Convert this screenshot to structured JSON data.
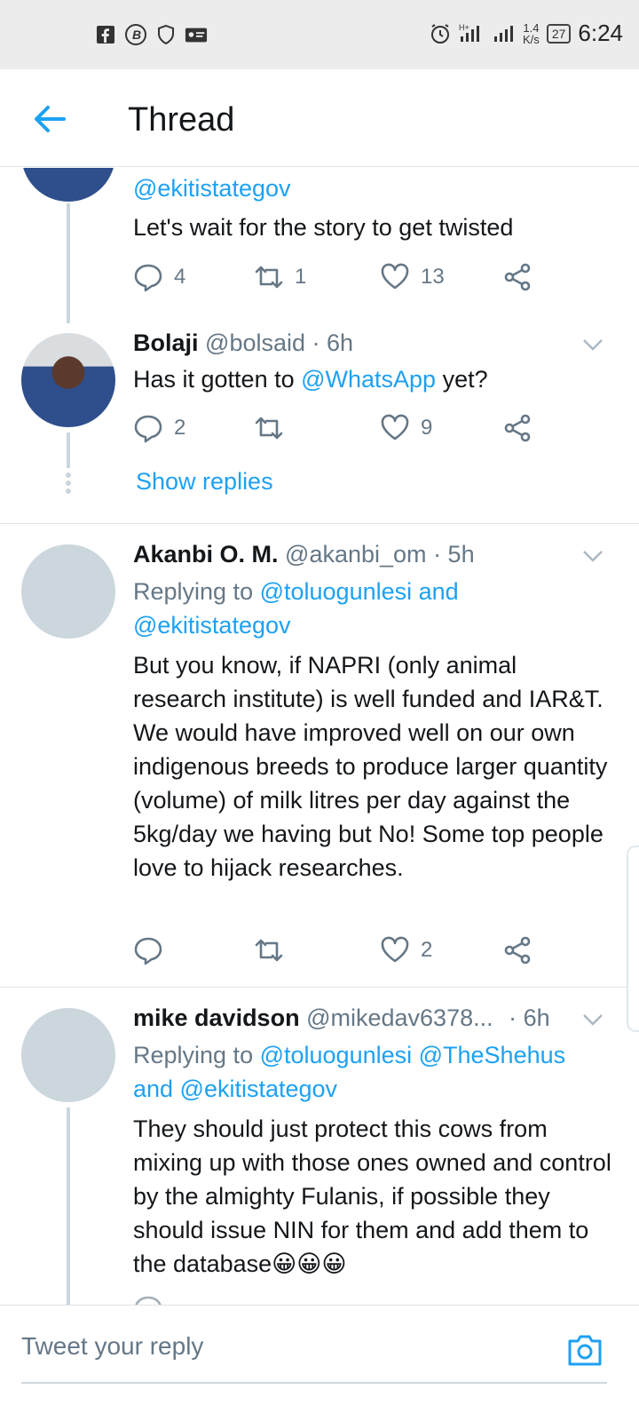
{
  "status_bar": {
    "time": "6:24",
    "speed_value": "1.4",
    "speed_unit": "K/s",
    "battery": "27",
    "left_icons": [
      "facebook-icon",
      "b-icon",
      "shield-icon",
      "id-card-icon"
    ],
    "right_icons": [
      "alarm-icon",
      "signal-hplus-icon",
      "signal-icon"
    ]
  },
  "header": {
    "title": "Thread"
  },
  "tweets": [
    {
      "partial_mention": "@ekitistategov",
      "text": "Let's wait for the story to get twisted",
      "replies": "4",
      "retweets": "1",
      "likes": "13"
    },
    {
      "name": "Bolaji",
      "handle": "@bolsaid",
      "time": "· 6h",
      "text_before": "Has it gotten to ",
      "text_mention": "@WhatsApp",
      "text_after": " yet?",
      "replies": "2",
      "retweets": "",
      "likes": "9",
      "show_replies": "Show replies"
    },
    {
      "name": "Akanbi O. M.",
      "handle": "@akanbi_om",
      "time": "· 5h",
      "replying_prefix": "Replying to ",
      "replying_line1": "@toluogunlesi and",
      "replying_line2": "@ekitistategov",
      "text": "But you know, if NAPRI (only animal research institute) is well funded and IAR&T. We would have improved well on our own indigenous breeds to produce larger quantity (volume) of milk litres per day against the 5kg/day we having but No! Some top people love to hijack researches.",
      "replies": "",
      "retweets": "",
      "likes": "2"
    },
    {
      "name": "mike davidson",
      "handle": "@mikedav6378...",
      "time": "· 6h",
      "replying_prefix": "Replying to ",
      "replying_line1": "@toluogunlesi @TheShehus",
      "replying_line2": "and @ekitistategov",
      "text": "They should just protect this cows from mixing up with those ones owned and control by the almighty Fulanis, if possible they should issue NIN for them and add them to the database😀😀😀"
    }
  ],
  "reply_bar": {
    "placeholder": "Tweet your reply"
  },
  "colors": {
    "accent": "#1da1f2",
    "muted": "#657786",
    "divider": "#dde3e8",
    "status_bar": "#ececec"
  }
}
